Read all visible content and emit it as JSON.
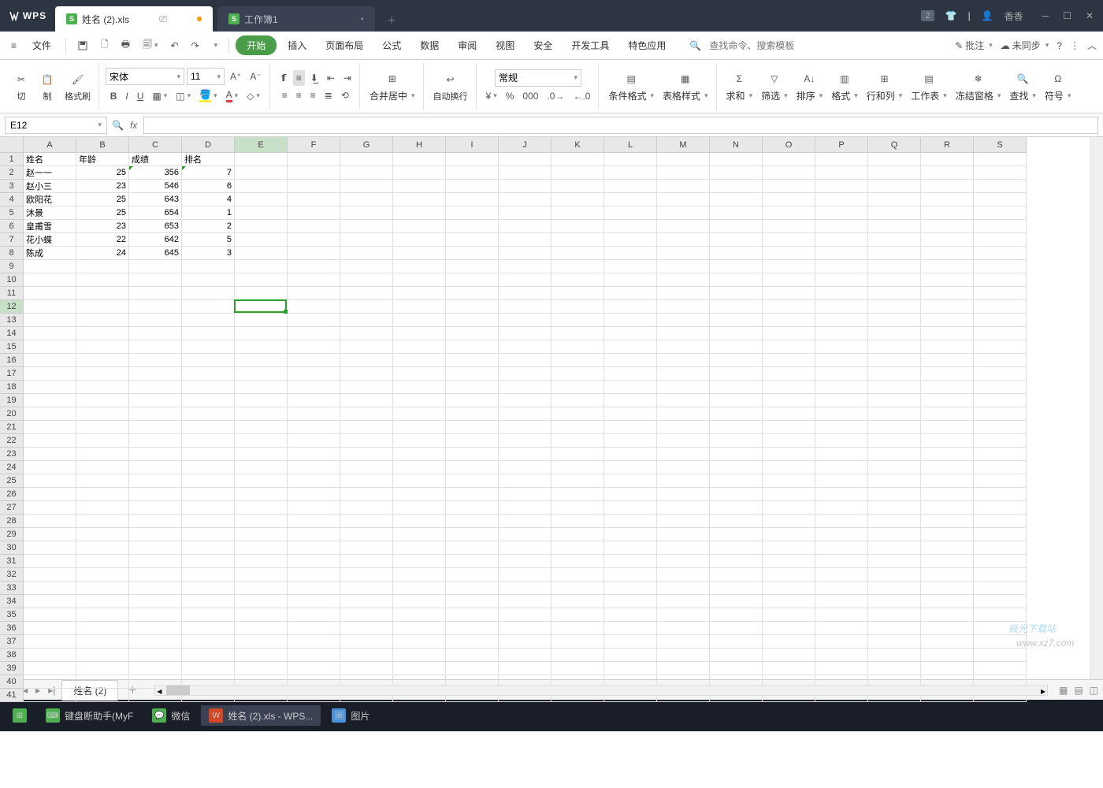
{
  "app": {
    "name": "WPS",
    "user": "香香"
  },
  "titlebar": {
    "tabs": [
      {
        "label": "姓名 (2).xls",
        "active": true,
        "modified": true
      },
      {
        "label": "工作簿1",
        "active": false,
        "modified": false
      }
    ],
    "badge": "2"
  },
  "menu": {
    "file": "文件",
    "items": [
      "开始",
      "插入",
      "页面布局",
      "公式",
      "数据",
      "审阅",
      "视图",
      "安全",
      "开发工具",
      "特色应用"
    ],
    "search_placeholder": "查找命令、搜索模板",
    "annotate": "批注",
    "sync": "未同步"
  },
  "ribbon": {
    "clipboard": {
      "cut": "切",
      "copy": "制",
      "paint": "格式刷"
    },
    "font": {
      "name": "宋体",
      "size": "11"
    },
    "align": {
      "merge": "合并居中",
      "wrap": "自动换行"
    },
    "number": {
      "format": "常规"
    },
    "style": {
      "cond": "条件格式",
      "tbl": "表格样式"
    },
    "edit": {
      "sum": "求和",
      "filter": "筛选",
      "sort": "排序",
      "format": "格式",
      "rowcol": "行和列",
      "sheet": "工作表",
      "freeze": "冻结窗格",
      "find": "查找",
      "symbol": "符号"
    }
  },
  "namebox": {
    "ref": "E12"
  },
  "grid": {
    "columns": [
      "A",
      "B",
      "C",
      "D",
      "E",
      "F",
      "G",
      "H",
      "I",
      "J",
      "K",
      "L",
      "M",
      "N",
      "O",
      "P",
      "Q",
      "R",
      "S"
    ],
    "row_count": 41,
    "headers": [
      "姓名",
      "年龄",
      "成绩",
      "排名"
    ],
    "data": [
      [
        "赵一一",
        "25",
        "356",
        "7"
      ],
      [
        "赵小三",
        "23",
        "546",
        "6"
      ],
      [
        "欧阳花",
        "25",
        "643",
        "4"
      ],
      [
        "沐景",
        "25",
        "654",
        "1"
      ],
      [
        "皇甫雪",
        "23",
        "653",
        "2"
      ],
      [
        "花小蝶",
        "22",
        "642",
        "5"
      ],
      [
        "陈成",
        "24",
        "645",
        "3"
      ]
    ],
    "active_cell": {
      "col": 4,
      "row": 11,
      "ref": "E12"
    }
  },
  "sheets": {
    "nav": [
      "|◂",
      "◂",
      "▸",
      "▸|"
    ],
    "active": "姓名 (2)"
  },
  "status": {
    "watermark": "极光下载站",
    "url": "www.xz7.com"
  },
  "taskbar": {
    "items": [
      {
        "label": "键盘断助手(MyF",
        "color": "#4caf50"
      },
      {
        "label": "微信",
        "color": "#4caf50"
      },
      {
        "label": "姓名 (2).xls - WPS...",
        "color": "#d24726",
        "active": true
      },
      {
        "label": "图片",
        "color": "#4a90d9"
      }
    ]
  }
}
